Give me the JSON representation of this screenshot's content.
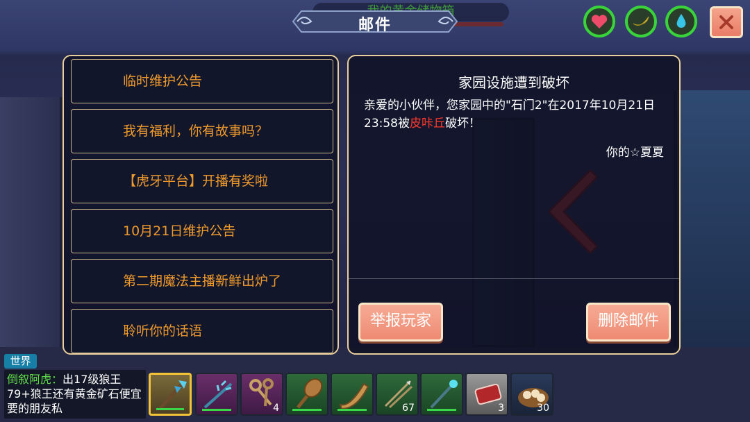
{
  "background": {
    "storage_label": "我的黄金储物箱"
  },
  "header": {
    "title": "邮件",
    "status_icons": [
      {
        "name": "heart-icon",
        "color": "#ee4b6a"
      },
      {
        "name": "banana-icon",
        "color": "#f4dc4a"
      },
      {
        "name": "water-drop-icon",
        "color": "#38c6e8"
      }
    ],
    "close_icon": "close-icon"
  },
  "mail_list": {
    "items": [
      {
        "label": "临时维护公告"
      },
      {
        "label": "我有福利，你有故事吗？"
      },
      {
        "label": "【虎牙平台】开播有奖啦"
      },
      {
        "label": "10月21日维护公告"
      },
      {
        "label": "第二期魔法主播新鲜出炉了"
      },
      {
        "label": "聆听你的话语"
      }
    ]
  },
  "mail_detail": {
    "title": "家园设施遭到破坏",
    "body_part1": "亲爱的小伙伴，您家园中的\"石门2\"在2017年10月21日 23:58被",
    "body_highlight": "皮咔丘",
    "body_part2": "破坏！",
    "signature": "你的☆夏夏",
    "report_button": "举报玩家",
    "delete_button": "删除邮件"
  },
  "chat": {
    "channel": "世界",
    "sender": "倒叙阿虎：",
    "message": "出17级狼王79+狼王还有黄金矿石便宜要的朋友私"
  },
  "hotbar": {
    "slots": [
      {
        "item": "ice-staff-icon",
        "quantity": ""
      },
      {
        "item": "thorn-wand-icon",
        "quantity": ""
      },
      {
        "item": "keys-icon",
        "quantity": "4"
      },
      {
        "item": "wooden-club-icon",
        "quantity": ""
      },
      {
        "item": "horn-icon",
        "quantity": ""
      },
      {
        "item": "arrows-icon",
        "quantity": "67"
      },
      {
        "item": "crystal-wand-icon",
        "quantity": ""
      },
      {
        "item": "raw-meat-icon",
        "quantity": "3"
      },
      {
        "item": "dumplings-icon",
        "quantity": "30"
      }
    ]
  }
}
